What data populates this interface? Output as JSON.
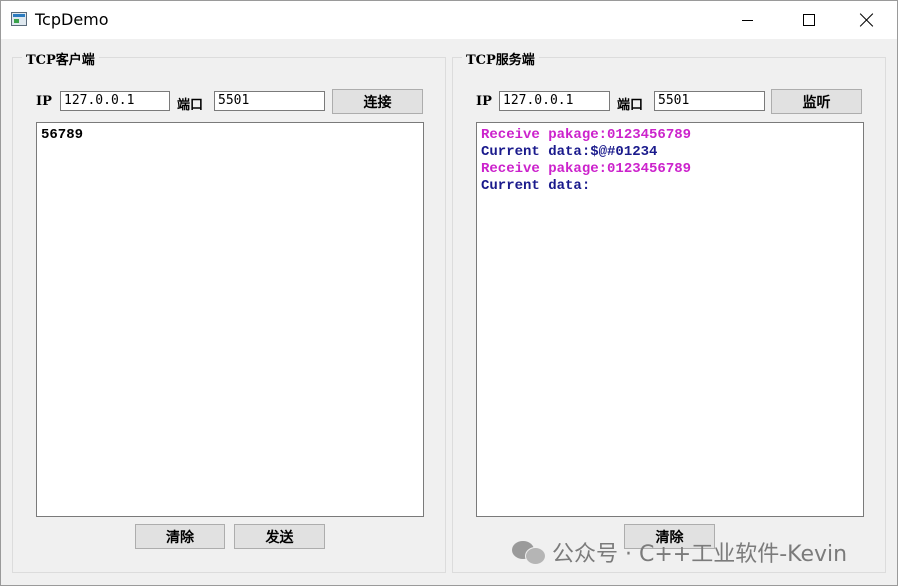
{
  "window": {
    "title": "TcpDemo"
  },
  "client": {
    "group_title": "TCP客户端",
    "ip_label": "IP",
    "ip_value": "127.0.0.1",
    "port_label": "端口",
    "port_value": "5501",
    "connect_label": "连接",
    "text": "56789",
    "clear_label": "清除",
    "send_label": "发送"
  },
  "server": {
    "group_title": "TCP服务端",
    "ip_label": "IP",
    "ip_value": "127.0.0.1",
    "port_label": "端口",
    "port_value": "5501",
    "listen_label": "监听",
    "log": [
      {
        "text": "Receive pakage:0123456789",
        "color": "#cc22cc"
      },
      {
        "text": "Current data:$@#01234",
        "color": "#1a1a8c"
      },
      {
        "text": "Receive pakage:0123456789",
        "color": "#cc22cc"
      },
      {
        "text": "Current data:",
        "color": "#1a1a8c"
      }
    ],
    "clear_label": "清除"
  },
  "watermark": {
    "text": "公众号 · C++工业软件-Kevin"
  }
}
